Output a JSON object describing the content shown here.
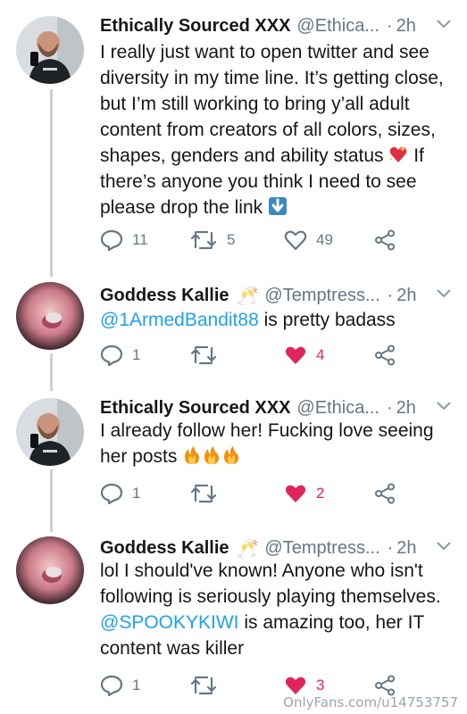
{
  "tweets": [
    {
      "name": "Ethically Sourced XXX",
      "handle": "@Ethica...",
      "sep": "·",
      "time": "2h",
      "text_before": "I really just want to open twitter and see diversity in my time line. It’s getting close, but I’m still working to bring y’all adult content from creators of all colors, sizes, shapes, genders and ability status ",
      "text_middle": " If there’s anyone you think I need to see please drop the link ",
      "replies": "11",
      "retweets": "5",
      "likes": "49",
      "icons": [
        "sparkling-heart-icon",
        "down-arrow-icon"
      ]
    },
    {
      "name": "Goddess Kallie",
      "badge": "🥂",
      "handle": "@Temptress...",
      "sep": "·",
      "time": "2h",
      "mention": "@1ArmedBandit88",
      "text_after": " is pretty badass",
      "replies": "1",
      "retweets": "",
      "likes": "4",
      "liked": true
    },
    {
      "name": "Ethically Sourced XXX",
      "handle": "@Ethica...",
      "sep": "·",
      "time": "2h",
      "text_before": "I already follow her! Fucking love seeing her posts ",
      "replies": "1",
      "retweets": "",
      "likes": "2",
      "liked": true,
      "icons": [
        "fire-icon",
        "fire-icon",
        "fire-icon"
      ]
    },
    {
      "name": "Goddess Kallie",
      "badge": "🥂",
      "handle": "@Temptress...",
      "sep": "·",
      "time": "2h",
      "text_before": "lol I should've known! Anyone who isn't following is seriously playing themselves. ",
      "mention": "@SPOOKYKIWI",
      "text_after": " is amazing too, her IT content was killer",
      "replies": "1",
      "retweets": "",
      "likes": "3",
      "liked": true
    }
  ],
  "watermark": "OnlyFans.com/u14753757",
  "colors": {
    "accent": "#1da1f2",
    "like": "#e0245e",
    "muted": "#657786",
    "thread": "#c8d1d9"
  }
}
